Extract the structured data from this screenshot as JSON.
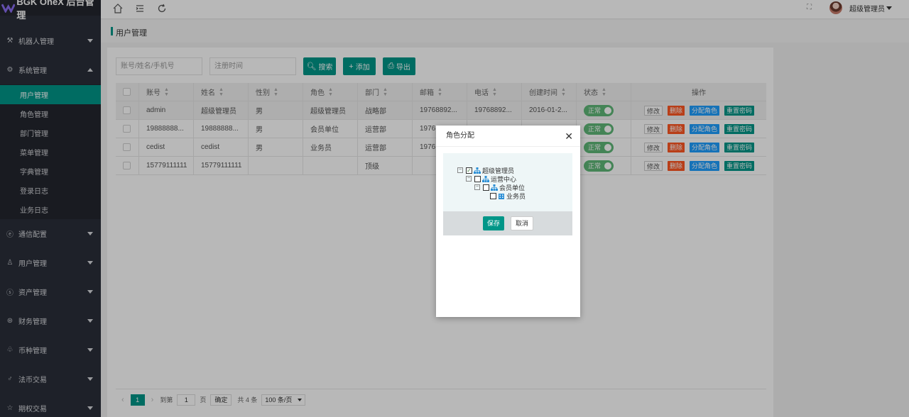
{
  "app": {
    "logo_text": "BGK OneX 后台管理"
  },
  "topbar": {
    "home_icon": "home-icon",
    "menu_icon": "menu-fold-icon",
    "refresh_icon": "refresh-icon",
    "user_name": "超级管理员"
  },
  "sidebar": {
    "items": [
      {
        "label": "机器人管理",
        "icon": "robot-icon",
        "glyph": "⚒"
      },
      {
        "label": "系统管理",
        "icon": "gear-icon",
        "glyph": "⚙",
        "expanded": true
      },
      {
        "label": "通信配置",
        "icon": "comm-icon",
        "glyph": "ⓔ"
      },
      {
        "label": "用户管理",
        "icon": "user-icon",
        "glyph": "♙"
      },
      {
        "label": "资产管理",
        "icon": "asset-icon",
        "glyph": "ⓢ"
      },
      {
        "label": "财务管理",
        "icon": "finance-icon",
        "glyph": "⊛"
      },
      {
        "label": "币种管理",
        "icon": "coin-icon",
        "glyph": "♧"
      },
      {
        "label": "法币交易",
        "icon": "fiat-icon",
        "glyph": "♂"
      },
      {
        "label": "期权交易",
        "icon": "option-icon",
        "glyph": "☆"
      }
    ],
    "sub_items": [
      "用户管理",
      "角色管理",
      "部门管理",
      "菜单管理",
      "字典管理",
      "登录日志",
      "业务日志"
    ]
  },
  "breadcrumb": "用户管理",
  "toolbar": {
    "search_placeholder": "账号/姓名/手机号",
    "date_placeholder": "注册时间",
    "search_label": "搜索",
    "add_label": "添加",
    "export_label": "导出"
  },
  "table": {
    "headers": [
      "账号",
      "姓名",
      "性别",
      "角色",
      "部门",
      "邮箱",
      "电话",
      "创建时间",
      "状态",
      "操作"
    ],
    "rows": [
      {
        "account": "admin",
        "name": "超级管理员",
        "gender": "男",
        "role": "超级管理员",
        "dept": "战略部",
        "email": "19768892...",
        "phone": "19768892...",
        "created": "2016-01-2...",
        "status": "正常"
      },
      {
        "account": "19888888...",
        "name": "19888888...",
        "gender": "男",
        "role": "会员单位",
        "dept": "运营部",
        "email": "1976",
        "phone": "",
        "created": "",
        "status": "正常"
      },
      {
        "account": "cedist",
        "name": "cedist",
        "gender": "男",
        "role": "业务员",
        "dept": "运营部",
        "email": "1976",
        "phone": "",
        "created": "",
        "status": "正常"
      },
      {
        "account": "15779111111",
        "name": "15779111111",
        "gender": "",
        "role": "",
        "dept": "顶级",
        "email": "",
        "phone": "",
        "created": "",
        "status": "正常"
      }
    ],
    "ops": {
      "edit": "修改",
      "delete": "删除",
      "assign_role": "分配角色",
      "reset_pwd": "重置密码"
    }
  },
  "pager": {
    "current_page": "1",
    "goto_label": "到第",
    "goto_value": "1",
    "page_unit": "页",
    "confirm": "确定",
    "total": "共 4 条",
    "page_size": "100 条/页"
  },
  "modal": {
    "title": "角色分配",
    "tree": [
      {
        "label": "超级管理员",
        "checked": true,
        "level": 0
      },
      {
        "label": "运营中心",
        "checked": false,
        "level": 1
      },
      {
        "label": "会员单位",
        "checked": false,
        "level": 2
      },
      {
        "label": "业务员",
        "checked": false,
        "level": 3
      }
    ],
    "save": "保存",
    "cancel": "取消"
  },
  "colors": {
    "primary": "#009688",
    "sidebar_bg": "#2a2f3a",
    "danger": "#ff5722",
    "info": "#1e9fff",
    "switch_on": "#5fb878"
  }
}
